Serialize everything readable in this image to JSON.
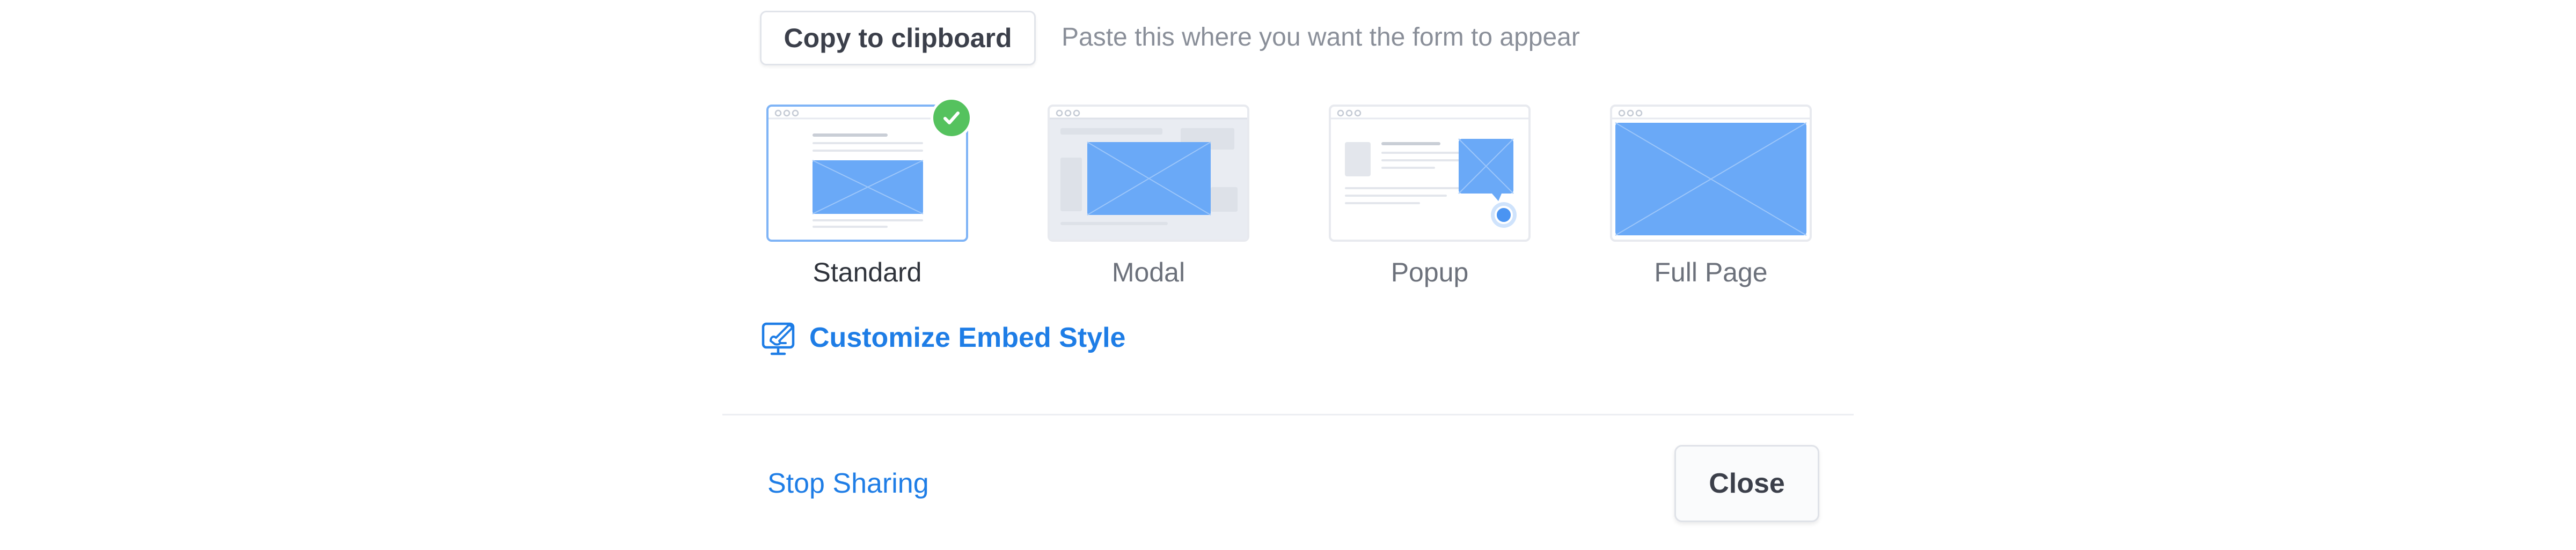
{
  "copy": {
    "button_label": "Copy to clipboard",
    "hint": "Paste this where you want the form to appear"
  },
  "embed_styles": [
    {
      "label": "Standard",
      "selected": true
    },
    {
      "label": "Modal",
      "selected": false
    },
    {
      "label": "Popup",
      "selected": false
    },
    {
      "label": "Full Page",
      "selected": false
    }
  ],
  "customize": {
    "label": "Customize Embed Style",
    "icon": "paintbrush-monitor-icon"
  },
  "footer": {
    "stop_label": "Stop Sharing",
    "close_label": "Close"
  },
  "colors": {
    "accent": "#1e7de6",
    "success": "#55c25e",
    "placeholder": "#6aa9f7"
  }
}
